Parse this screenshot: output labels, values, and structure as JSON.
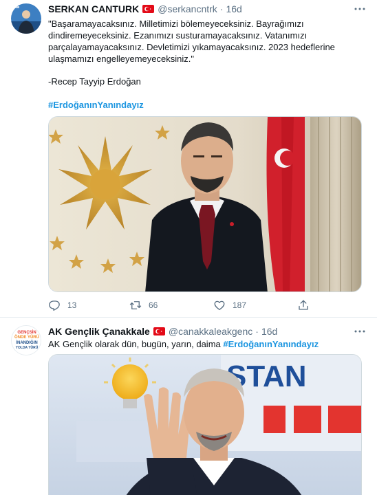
{
  "tweets": [
    {
      "author_name": "SERKAN CANTURK",
      "handle": "@serkancntrk",
      "separator": "·",
      "time": "16d",
      "text_lines": [
        "\"Başaramayacaksınız. Milletimizi bölemeyeceksiniz. Bayrağımızı",
        "dindiremeyeceksiniz. Ezanımızı susturamayacaksınız. Vatanımızı",
        "parçalayamayacaksınız. Devletimizi yıkamayacaksınız. 2023 hedeflerine",
        "ulaşmamızı engelleyemeyeceksiniz.\""
      ],
      "signature": "-Recep Tayyip Erdoğan",
      "hashtag": "#ErdoğanınYanındayız",
      "reply_count": "13",
      "retweet_count": "66",
      "like_count": "187"
    },
    {
      "author_name": "AK Gençlik Çanakkale",
      "handle": "@canakkaleakgenc",
      "separator": "·",
      "time": "16d",
      "text": "AK Gençlik olarak dün, bugün, yarın, daima ",
      "hashtag": "#ErdoğanınYanındayız",
      "avatar_text": [
        "GENÇSİN",
        "ÖNDE YÜRÜ",
        "İNANDIĞIN",
        "YOLDA YÜRÜ"
      ],
      "photo_text": "STAN"
    }
  ],
  "colors": {
    "text": "#0f1419",
    "secondary": "#5b7083",
    "link": "#1b95e0",
    "flag_red": "#e30a17",
    "divider": "#e6ecf0"
  },
  "icons": [
    "turkish-flag-icon",
    "more-icon",
    "reply-icon",
    "retweet-icon",
    "like-icon",
    "share-icon"
  ]
}
